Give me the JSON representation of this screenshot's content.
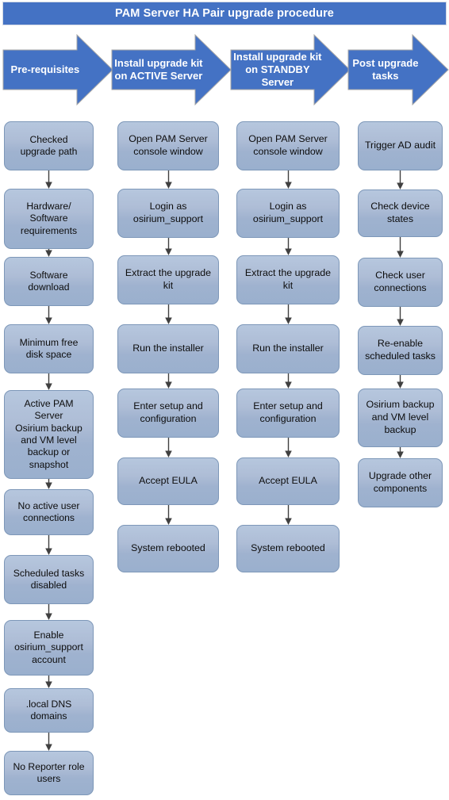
{
  "title": {
    "text": "PAM Server HA Pair upgrade procedure",
    "background": "#4472C4",
    "color": "#ffffff"
  },
  "theme": {
    "arrow_fill": "#4472C4",
    "arrow_stroke": "#a6a6a6",
    "box_fill_top": "#b6c7de",
    "box_fill_bottom": "#9ab0ce",
    "box_border": "#7d97b8",
    "connector_color": "#404040",
    "text_color": "#0d0d0d"
  },
  "phases": [
    {
      "id": "pre-requisites",
      "label": "Pre-requisites"
    },
    {
      "id": "install-active",
      "label": "Install upgrade kit\non ACTIVE Server"
    },
    {
      "id": "install-standby",
      "label": "Install upgrade kit\non STANDBY\nServer"
    },
    {
      "id": "post-upgrade",
      "label": "Post upgrade\ntasks"
    }
  ],
  "columns": [
    {
      "id": "pre-requisites",
      "steps": [
        {
          "label": "Checked\nupgrade path"
        },
        {
          "label": "Hardware/\nSoftware\nrequirements"
        },
        {
          "label": "Software\ndownload"
        },
        {
          "label": "Minimum free\ndisk space"
        },
        {
          "label": "Active PAM\nServer\nOsirium backup\nand VM level\nbackup or\nsnapshot"
        },
        {
          "label": "No active user\nconnections"
        },
        {
          "label": "Scheduled tasks\ndisabled"
        },
        {
          "label": "Enable\nosirium_support\naccount"
        },
        {
          "label": ".local DNS\ndomains"
        },
        {
          "label": "No Reporter role\nusers"
        }
      ]
    },
    {
      "id": "install-active",
      "steps": [
        {
          "label": "Open PAM Server\nconsole window"
        },
        {
          "label": "Login as\nosirium_support"
        },
        {
          "label": "Extract the upgrade\nkit"
        },
        {
          "label": "Run the installer"
        },
        {
          "label": "Enter setup and\nconfiguration"
        },
        {
          "label": "Accept EULA"
        },
        {
          "label": "System rebooted"
        }
      ]
    },
    {
      "id": "install-standby",
      "steps": [
        {
          "label": "Open PAM Server\nconsole window"
        },
        {
          "label": "Login as\nosirium_support"
        },
        {
          "label": "Extract the upgrade\nkit"
        },
        {
          "label": "Run the installer"
        },
        {
          "label": "Enter setup and\nconfiguration"
        },
        {
          "label": "Accept EULA"
        },
        {
          "label": "System rebooted"
        }
      ]
    },
    {
      "id": "post-upgrade",
      "steps": [
        {
          "label": "Trigger AD audit"
        },
        {
          "label": "Check device\nstates"
        },
        {
          "label": "Check user\nconnections"
        },
        {
          "label": "Re-enable\nscheduled tasks"
        },
        {
          "label": "Osirium backup\nand VM level\nbackup"
        },
        {
          "label": "Upgrade other\ncomponents"
        }
      ]
    }
  ]
}
